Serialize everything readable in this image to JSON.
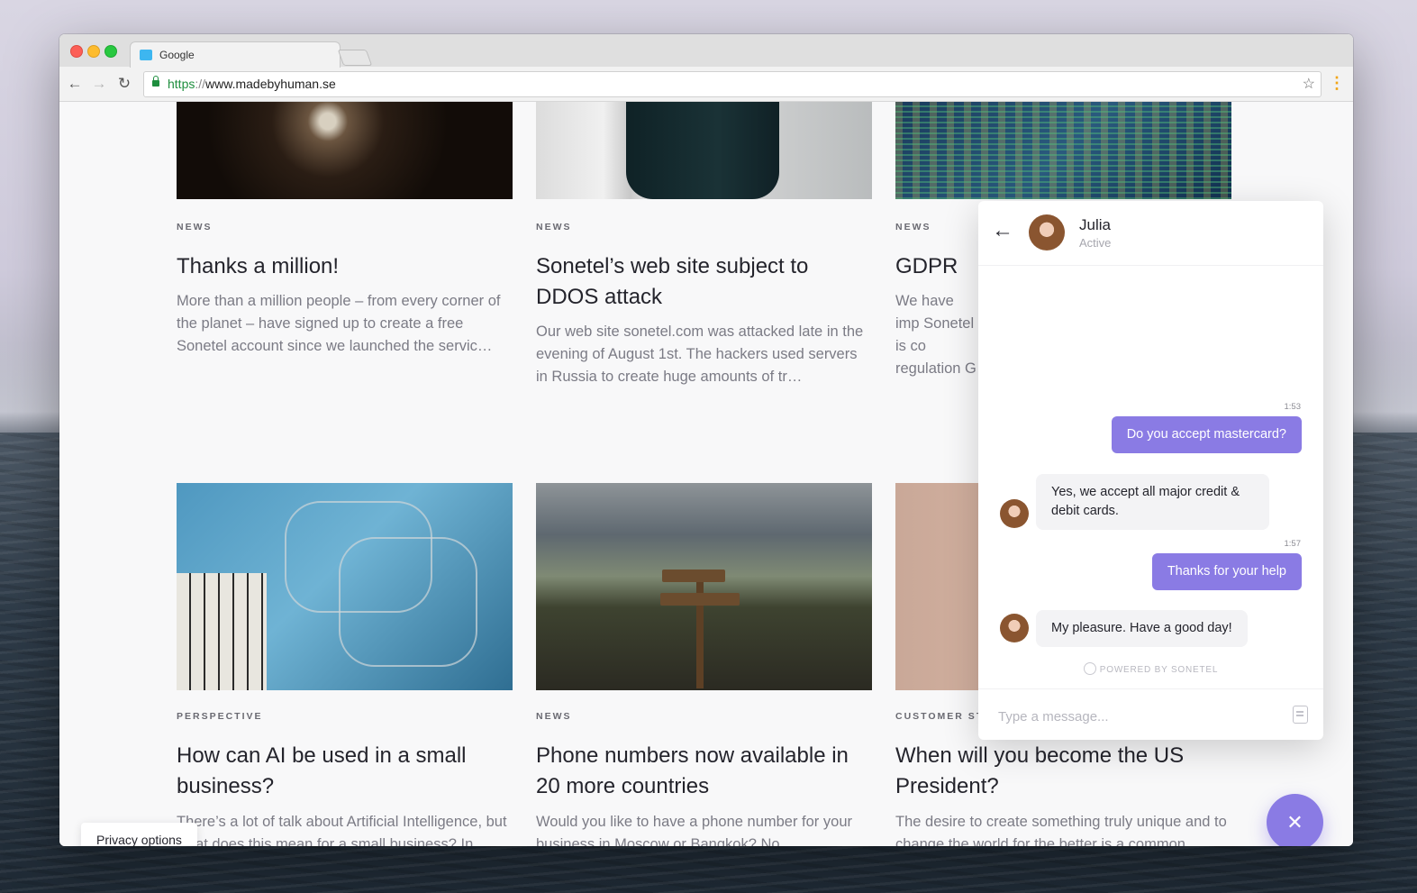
{
  "browser": {
    "tab_title": "Google",
    "url_protocol": "https",
    "url_separator": "://",
    "url_host": "www.madebyhuman.se",
    "back_icon": "arrow-left-icon",
    "forward_icon": "arrow-right-icon",
    "reload_icon": "reload-icon",
    "bookmark_icon": "star-icon",
    "menu_icon": "kebab-menu-icon"
  },
  "articles": [
    {
      "category": "NEWS",
      "title": "Thanks a million!",
      "excerpt": "More than a million people – from every corner of the planet – have signed up to create a free Sonetel account since we launched the servic…"
    },
    {
      "category": "NEWS",
      "title": "Sonetel’s web site subject to DDOS attack",
      "excerpt": "Our web site sonetel.com was attacked late in the evening of August 1st. The hackers used servers in Russia to create huge amounts of tr…"
    },
    {
      "category": "NEWS",
      "title": "GDPR",
      "excerpt": "We have imp Sonetel is co regulation G"
    },
    {
      "category": "PERSPECTIVE",
      "title": "How can AI be used in a small business?",
      "excerpt": "There’s a lot of talk about Artificial Intelligence, but what does this mean for a small business? In"
    },
    {
      "category": "NEWS",
      "title": "Phone numbers now available in 20 more countries",
      "excerpt": "Would you like to have a phone number for your business in Moscow or Bangkok? No"
    },
    {
      "category": "CUSTOMER STO",
      "title": "When will you become the US President?",
      "excerpt": "The desire to create something truly unique and to change the world for the better is a common"
    }
  ],
  "chat": {
    "agent_name": "Julia",
    "agent_status": "Active",
    "messages": [
      {
        "time": "1:53",
        "text": "Do you accept mastercard?",
        "from": "user"
      },
      {
        "text": "Yes, we accept all major credit & debit cards.",
        "from": "agent"
      },
      {
        "time": "1:57",
        "text": "Thanks for your help",
        "from": "user"
      },
      {
        "text": "My pleasure. Have a good day!",
        "from": "agent"
      }
    ],
    "powered_by": "POWERED BY SONETEL",
    "input_placeholder": "Type a message...",
    "accent_color": "#8a7be4"
  },
  "privacy_label": "Privacy options",
  "fab_icon": "close-icon"
}
